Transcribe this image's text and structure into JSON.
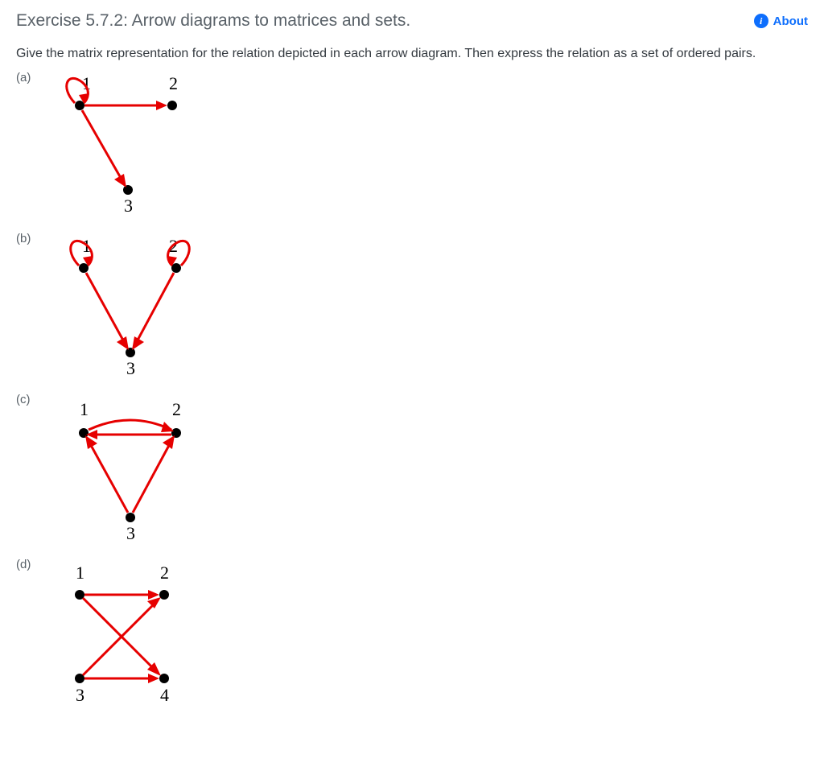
{
  "header": {
    "title": "Exercise 5.7.2: Arrow diagrams to matrices and sets.",
    "about_label": "About"
  },
  "instruction": "Give the matrix representation for the relation depicted in each arrow diagram. Then express the relation as a set of ordered pairs.",
  "parts": {
    "a": {
      "label": "(a)",
      "nodes": {
        "n1": "1",
        "n2": "2",
        "n3": "3"
      }
    },
    "b": {
      "label": "(b)",
      "nodes": {
        "n1": "1",
        "n2": "2",
        "n3": "3"
      }
    },
    "c": {
      "label": "(c)",
      "nodes": {
        "n1": "1",
        "n2": "2",
        "n3": "3"
      }
    },
    "d": {
      "label": "(d)",
      "nodes": {
        "n1": "1",
        "n2": "2",
        "n3": "3",
        "n4": "4"
      }
    }
  },
  "chart_data": [
    {
      "type": "diagram",
      "part": "a",
      "nodes": [
        1,
        2,
        3
      ],
      "edges": [
        [
          1,
          1
        ],
        [
          1,
          2
        ],
        [
          1,
          3
        ]
      ],
      "description": "Node 1 self-loop; arrow 1→2; arrow 1→3"
    },
    {
      "type": "diagram",
      "part": "b",
      "nodes": [
        1,
        2,
        3
      ],
      "edges": [
        [
          1,
          1
        ],
        [
          2,
          2
        ],
        [
          1,
          3
        ],
        [
          2,
          3
        ]
      ],
      "description": "Self-loops on 1 and 2; arrows 1→3 and 2→3"
    },
    {
      "type": "diagram",
      "part": "c",
      "nodes": [
        1,
        2,
        3
      ],
      "edges": [
        [
          1,
          2
        ],
        [
          2,
          1
        ],
        [
          3,
          1
        ],
        [
          3,
          2
        ]
      ],
      "description": "Arrows both ways between 1 and 2; arrows 3→1 and 3→2"
    },
    {
      "type": "diagram",
      "part": "d",
      "nodes": [
        1,
        2,
        3,
        4
      ],
      "edges": [
        [
          1,
          2
        ],
        [
          3,
          2
        ],
        [
          1,
          4
        ],
        [
          3,
          4
        ]
      ],
      "description": "Arrows 1→2, 3→2, 1→4, 3→4"
    }
  ]
}
